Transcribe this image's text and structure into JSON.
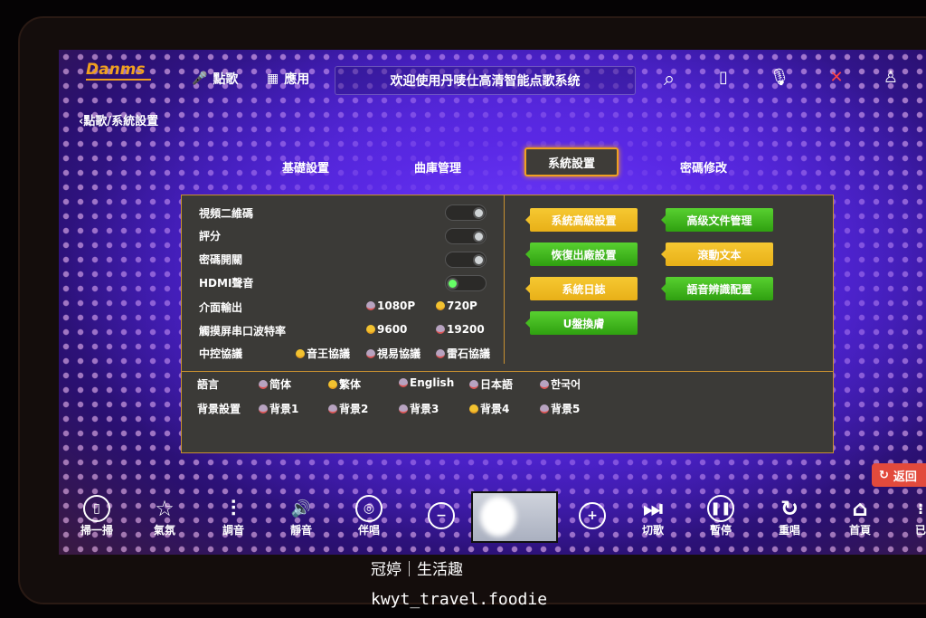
{
  "header": {
    "logo": "Danms",
    "nav": [
      {
        "label": "點歌",
        "icon": "microphone-icon"
      },
      {
        "label": "應用",
        "icon": "grid-icon"
      }
    ],
    "title": "欢迎使用丹唛仕高清智能点歌系统",
    "icons": [
      "search-icon",
      "usb-icon",
      "mic-icon",
      "wifi-icon",
      "user-icon"
    ]
  },
  "breadcrumb": "點歌/系統設置",
  "tabs": [
    {
      "label": "基礎設置"
    },
    {
      "label": "曲庫管理"
    },
    {
      "label": "系統設置",
      "active": true
    },
    {
      "label": "密碼修改"
    }
  ],
  "settings": {
    "toggles": [
      {
        "label": "視頻二維碼",
        "on": false
      },
      {
        "label": "評分",
        "on": false
      },
      {
        "label": "密碼開關",
        "on": false
      },
      {
        "label": "HDMI聲音",
        "on": true
      }
    ],
    "interface_output": {
      "label": "介面輸出",
      "options": [
        "1080P",
        "720P"
      ],
      "selected": "720P"
    },
    "baud_rate": {
      "label": "觸摸屏串口波特率",
      "options": [
        "9600",
        "19200"
      ],
      "selected": "9600"
    },
    "protocol": {
      "label": "中控協議",
      "options": [
        "音王協議",
        "視易協議",
        "雷石協議"
      ],
      "selected": "音王協議"
    },
    "language": {
      "label": "語言",
      "options": [
        "简体",
        "繁体",
        "English",
        "日本語",
        "한국어"
      ],
      "selected": "繁体"
    },
    "background": {
      "label": "背景設置",
      "options": [
        "背景1",
        "背景2",
        "背景3",
        "背景4",
        "背景5"
      ],
      "selected": "背景4"
    }
  },
  "buttons": [
    {
      "label": "系統高級設置",
      "color": "#f0bf28"
    },
    {
      "label": "高级文件管理",
      "color": "#45bb20"
    },
    {
      "label": "恢復出廠設置",
      "color": "#45bb20"
    },
    {
      "label": "滾動文本",
      "color": "#f0bf28"
    },
    {
      "label": "系統日誌",
      "color": "#f0bf28"
    },
    {
      "label": "語音辨識配置",
      "color": "#45bb20"
    },
    {
      "label": "U盤換膚",
      "color": "#45bb20"
    }
  ],
  "return_label": "返回",
  "bottom_bar": {
    "left": [
      {
        "label": "掃一掃",
        "icon": "phone-icon"
      },
      {
        "label": "氣氛",
        "icon": "star-icon"
      },
      {
        "label": "調音",
        "icon": "equalizer-icon"
      },
      {
        "label": "靜音",
        "icon": "speaker-icon"
      },
      {
        "label": "伴唱",
        "icon": "disc-icon"
      }
    ],
    "right": [
      {
        "label": "切歌",
        "icon": "skip-icon"
      },
      {
        "label": "暫停",
        "icon": "pause-icon"
      },
      {
        "label": "重唱",
        "icon": "replay-icon"
      },
      {
        "label": "首頁",
        "icon": "home-icon"
      },
      {
        "label": "已",
        "icon": "list-icon"
      }
    ]
  },
  "watermark": {
    "line1": "冠婷｜生活趣",
    "line2": "kwyt_travel.foodie"
  }
}
